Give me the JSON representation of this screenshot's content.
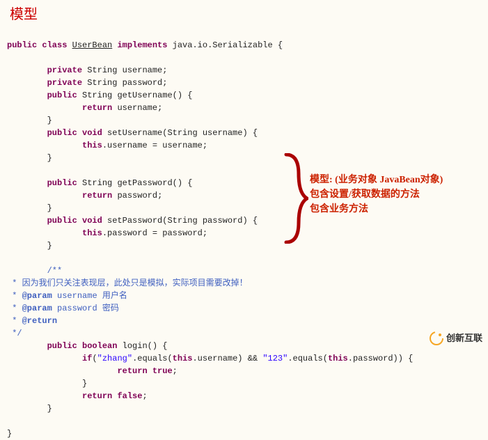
{
  "title": "模型",
  "class_decl": {
    "p1": "public class",
    "name": "UserBean",
    "p2": "implements",
    "p3": "java.io.Serializable {"
  },
  "f1": {
    "mod": "private",
    "type": "String username;"
  },
  "f2": {
    "mod": "private",
    "type": "String password;"
  },
  "m1": {
    "sig_mod": "public",
    "sig_rest": "String getUsername() {",
    "ret": "return",
    "ret_rest": "username;"
  },
  "m2": {
    "sig_mod": "public void",
    "sig_rest": "setUsername(String username) {",
    "body_kw": "this",
    "body_rest": ".username = username;"
  },
  "m3": {
    "sig_mod": "public",
    "sig_rest": "String getPassword() {",
    "ret": "return",
    "ret_rest": "password;"
  },
  "m4": {
    "sig_mod": "public void",
    "sig_rest": "setPassword(String password) {",
    "body_kw": "this",
    "body_rest": ".password = password;"
  },
  "doc": {
    "open": "/**",
    "l1": " * 因为我们只关注表现层，此处只是模拟，实际项目需要改掉！",
    "l2a": " * ",
    "l2tag": "@param",
    "l2b": " username 用户名",
    "l3a": " * ",
    "l3tag": "@param",
    "l3b": " password 密码",
    "l4a": " * ",
    "l4tag": "@return",
    "close": " */"
  },
  "m5": {
    "sig_mod": "public boolean",
    "sig_rest": "login() {",
    "if_kw": "if",
    "if_a": "(",
    "s1": "\"zhang\"",
    "if_b": ".equals(",
    "this1": "this",
    "if_c": ".username) && ",
    "s2": "\"123\"",
    "if_d": ".equals(",
    "this2": "this",
    "if_e": ".password)) {",
    "ret_t": "return true",
    "semi1": ";",
    "ret_f": "return false",
    "semi2": ";"
  },
  "close_brace": "}",
  "annot": {
    "l1": "模型: (业务对象 JavaBean对象)",
    "l2": "包含设置/获取数据的方法",
    "l3": "包含业务方法"
  },
  "logo_text": "创新互联"
}
